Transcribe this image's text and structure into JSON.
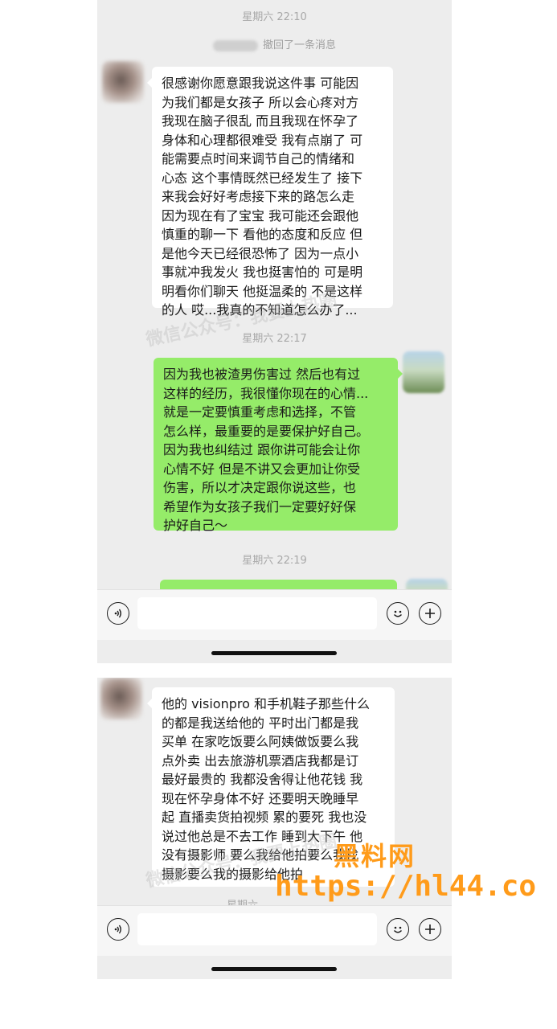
{
  "chat1": {
    "timestamp1": "星期六 22:10",
    "recall_text": "撤回了一条消息",
    "msg_left_1": "很感谢你愿意跟我说这件事 可能因\n为我们都是女孩子 所以会心疼对方\n我现在脑子很乱 而且我现在怀孕了\n身体和心理都很难受 我有点崩了 可\n能需要点时间来调节自己的情绪和\n心态 这个事情既然已经发生了 接下\n来我会好好考虑接下来的路怎么走\n因为现在有了宝宝 我可能还会跟他\n慎重的聊一下 看他的态度和反应 但\n是他今天已经很恐怖了 因为一点小\n事就冲我发火 我也挺害怕的 可是明\n明看你们聊天 他挺温柔的 不是这样\n的人 哎...我真的不知道怎么办了...",
    "watermark": "微信公众号：我要上热圈",
    "timestamp2": "星期六 22:17",
    "msg_right_1": "因为我也被渣男伤害过 然后也有过\n这样的经历，我很懂你现在的心情...\n就是一定要慎重考虑和选择，不管\n怎么样，最重要的是要保护好自己。\n因为我也纠结过 跟你讲可能会让你\n心情不好 但是不讲又会更加让你受\n伤害，所以才决定跟你说这些，也\n希望作为女孩子我们一定要好好保\n护好自己～",
    "timestamp3": "星期六 22:19"
  },
  "chat2": {
    "msg_left_2": "他的 visionpro 和手机鞋子那些什么\n的都是我送给他的 平时出门都是我\n买单 在家吃饭要么阿姨做饭要么我\n点外卖 出去旅游机票酒店我都是订\n最好最贵的 我都没舍得让他花钱 我\n现在怀孕身体不好 还要明天晚睡早\n起 直播卖货拍视频 累的要死 我也没\n说过他总是不去工作 睡到大下午 他\n没有摄影师 要么我给他拍要么我找\n摄影要么我的摄影给他拍",
    "watermark": "微信公众号：我要上热圈",
    "timestamp_partial": "星期六"
  },
  "input_bar": {
    "voice_icon": "voice-icon",
    "emoji_icon": "emoji-icon",
    "plus_icon": "plus-icon"
  },
  "overlay": {
    "logo_text": "黑料网",
    "url_text": "https://hl44.co"
  },
  "colors": {
    "chat_bg": "#ededed",
    "bubble_green": "#95ec69",
    "bubble_white": "#ffffff",
    "overlay_orange": "#ff9b1a"
  }
}
